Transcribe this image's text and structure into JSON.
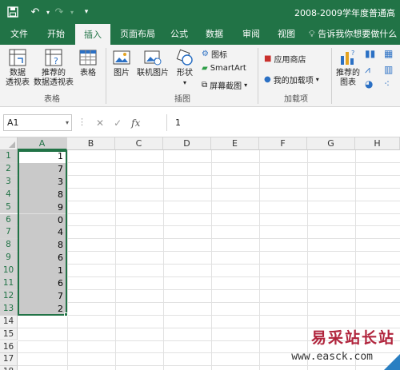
{
  "titlebar": {
    "title": "2008-2009学年度普通高",
    "icons": [
      "save-icon",
      "undo-icon",
      "redo-icon",
      "customize-quick-access-icon"
    ]
  },
  "tabs": [
    {
      "label": "文件"
    },
    {
      "label": "开始"
    },
    {
      "label": "插入",
      "active": true
    },
    {
      "label": "页面布局"
    },
    {
      "label": "公式"
    },
    {
      "label": "数据"
    },
    {
      "label": "审阅"
    },
    {
      "label": "视图"
    }
  ],
  "tell_me": "告诉我你想要做什么",
  "ribbon": {
    "pivot_table": "数据\n透视表",
    "recommended_pivot": "推荐的\n数据透视表",
    "table": "表格",
    "group_tables": "表格",
    "pictures": "图片",
    "online_pictures": "联机图片",
    "shapes": "形状",
    "icons": "图标",
    "smartart": "SmartArt",
    "screenshot": "屏幕截图",
    "group_illustrations": "插图",
    "app_store": "应用商店",
    "my_addins": "我的加载项",
    "group_addins": "加载项",
    "recommended_charts": "推荐的\n图表"
  },
  "formula_bar": {
    "name_box": "A1",
    "fx": "fx",
    "value": "1"
  },
  "grid": {
    "columns": [
      "A",
      "B",
      "C",
      "D",
      "E",
      "F",
      "G",
      "H"
    ],
    "rows": [
      "1",
      "2",
      "3",
      "4",
      "5",
      "6",
      "7",
      "8",
      "9",
      "10",
      "11",
      "12",
      "13",
      "14",
      "15",
      "16",
      "17",
      "18"
    ],
    "columnA_values": [
      "1",
      "7",
      "3",
      "8",
      "9",
      "0",
      "4",
      "8",
      "6",
      "1",
      "6",
      "7",
      "2"
    ]
  },
  "watermark": {
    "title": "易采站长站",
    "url": "www.easck.com"
  },
  "colors": {
    "accent": "#217346",
    "selection": "#c9c9c9",
    "watermark_red": "#b1253d"
  }
}
